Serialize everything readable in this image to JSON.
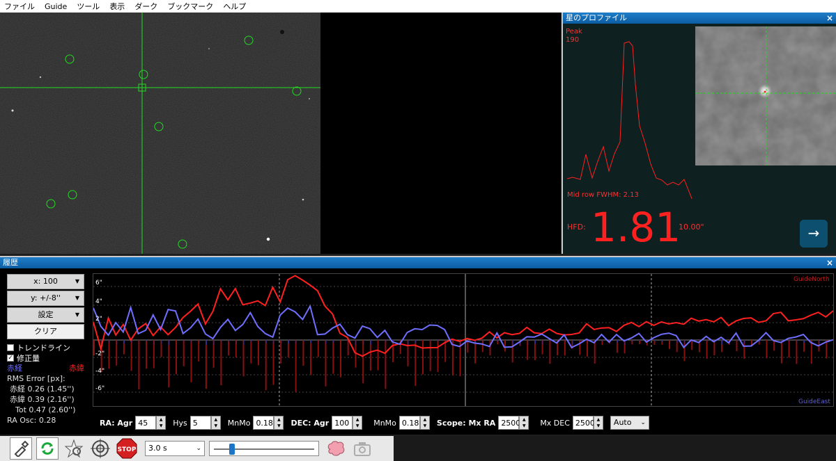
{
  "menu": [
    "ファイル",
    "Guide",
    "ツール",
    "表示",
    "ダーク",
    "ブックマーク",
    "ヘルプ"
  ],
  "profile": {
    "title": "星のプロファイル",
    "close": "×",
    "peak_label": "Peak",
    "peak_value": "190",
    "fwhm": "Mid row FWHM: 2.13",
    "hfd_label": "HFD:",
    "hfd_value": "1.81",
    "hfd_arcsec": "10.00\"",
    "arrow": "→"
  },
  "history": {
    "title": "履歴",
    "close": "×",
    "x_scale": "x: 100",
    "y_scale": "y: +/-8''",
    "settings": "設定",
    "clear": "クリア",
    "trendline": "トレンドライン",
    "corrections": "修正量",
    "ra_label": "赤経",
    "dec_label": "赤緯",
    "rms_title": "RMS Error [px]:",
    "rms_ra": "赤経 0.26 (1.45'')",
    "rms_dec": "赤緯 0.39 (2.16'')",
    "rms_tot": "Tot 0.47 (2.60'')",
    "ra_osc": "RA Osc: 0.28",
    "legend_north": "GuideNorth",
    "legend_east": "GuideEast",
    "y_ticks": [
      "6\"",
      "4\"",
      "2\"",
      "-2\"",
      "-4\"",
      "-6\""
    ]
  },
  "params": {
    "ra_label": "RA: Agr",
    "ra_agr": "45",
    "hys_label": "Hys",
    "hys": "5",
    "mnmo_label": "MnMo",
    "ra_mnmo": "0.18",
    "dec_label": "DEC: Agr",
    "dec_agr": "100",
    "dec_mnmo_label": "MnMo",
    "dec_mnmo": "0.18",
    "scope_label": "Scope: Mx RA",
    "mx_ra": "2500",
    "mx_dec_label": "Mx DEC",
    "mx_dec": "2500",
    "mode": "Auto"
  },
  "toolbar": {
    "exposure": "3.0 s",
    "stop": "STOP"
  },
  "colors": {
    "ra": "#6f6fff",
    "dec": "#ff2020",
    "accent": "#1a75c9"
  }
}
